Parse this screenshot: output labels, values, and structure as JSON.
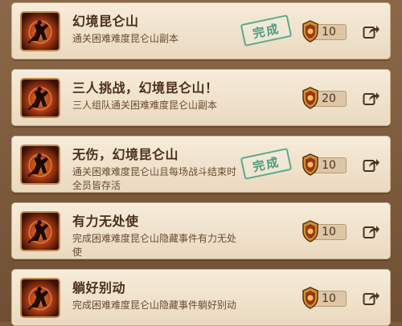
{
  "achievements": [
    {
      "title": "幻境昆仑山",
      "desc": "通关困难难度昆仑山副本",
      "completed": true,
      "stamp_label": "完成",
      "reward": "10",
      "icon": "warrior-icon",
      "share_icon": "share-icon"
    },
    {
      "title": "三人挑战，幻境昆仑山！",
      "desc": "三人组队通关困难难度昆仑山副本",
      "completed": false,
      "stamp_label": "",
      "reward": "20",
      "icon": "warrior-icon",
      "share_icon": "share-icon"
    },
    {
      "title": "无伤，幻境昆仑山",
      "desc": "通关困难难度昆仑山且每场战斗结束时全员皆存活",
      "completed": true,
      "stamp_label": "完成",
      "reward": "10",
      "icon": "warrior-icon",
      "share_icon": "share-icon"
    },
    {
      "title": "有力无处使",
      "desc": "完成困难难度昆仑山隐藏事件有力无处使",
      "completed": false,
      "stamp_label": "",
      "reward": "10",
      "icon": "warrior-icon",
      "share_icon": "share-icon"
    },
    {
      "title": "躺好别动",
      "desc": "完成困难难度昆仑山隐藏事件躺好别动",
      "completed": false,
      "stamp_label": "",
      "reward": "10",
      "icon": "warrior-icon",
      "share_icon": "share-icon"
    }
  ],
  "colors": {
    "stamp": "#4f9b7e",
    "card_bg": "#f1e4cd",
    "title": "#4a2e1a",
    "desc": "#6a4a32"
  }
}
